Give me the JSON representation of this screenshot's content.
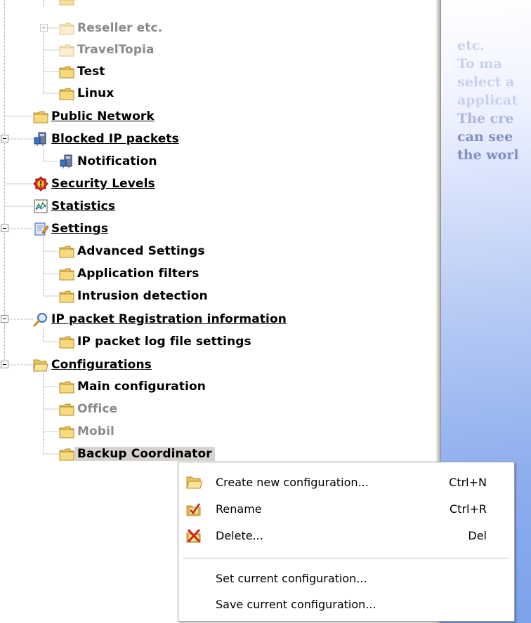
{
  "tree": {
    "items": [
      {
        "label": "Reseller etc.",
        "style": "dim"
      },
      {
        "label": "TravelTopia",
        "style": "dim"
      },
      {
        "label": "Test",
        "style": "normal"
      },
      {
        "label": "Linux",
        "style": "normal"
      },
      {
        "label": "Public Network",
        "style": "link"
      },
      {
        "label": "Blocked IP packets",
        "style": "link"
      },
      {
        "label": "Notification",
        "style": "normal"
      },
      {
        "label": "Security Levels",
        "style": "link"
      },
      {
        "label": "Statistics",
        "style": "link"
      },
      {
        "label": "Settings",
        "style": "link"
      },
      {
        "label": "Advanced Settings",
        "style": "normal"
      },
      {
        "label": "Application filters",
        "style": "normal"
      },
      {
        "label": "Intrusion detection",
        "style": "normal"
      },
      {
        "label": "IP packet Registration information",
        "style": "link"
      },
      {
        "label": "IP packet log file settings",
        "style": "normal"
      },
      {
        "label": "Configurations",
        "style": "link"
      },
      {
        "label": "Main configuration",
        "style": "normal"
      },
      {
        "label": "Office",
        "style": "dim"
      },
      {
        "label": "Mobil",
        "style": "dim"
      },
      {
        "label": "Backup Coordinator",
        "style": "selected"
      }
    ]
  },
  "right_pane": {
    "lines": [
      "etc.",
      "To ma",
      "select a",
      "applicat",
      "The cre",
      "can see",
      "the worl"
    ]
  },
  "context_menu": {
    "items": [
      {
        "label": "Create new configuration...",
        "shortcut": "Ctrl+N",
        "icon": "open-folder-icon"
      },
      {
        "label": "Rename",
        "shortcut": "Ctrl+R",
        "icon": "rename-checkbox-icon"
      },
      {
        "label": "Delete...",
        "shortcut": "Del",
        "icon": "delete-x-icon"
      },
      {
        "label": "Set current configuration...",
        "shortcut": "",
        "icon": ""
      },
      {
        "label": "Save current configuration...",
        "shortcut": "",
        "icon": ""
      }
    ]
  },
  "colors": {
    "selection": "#d6d3ce",
    "folder": "#f5d67a",
    "right_pane_gradient_end": "#7ba2ea"
  }
}
